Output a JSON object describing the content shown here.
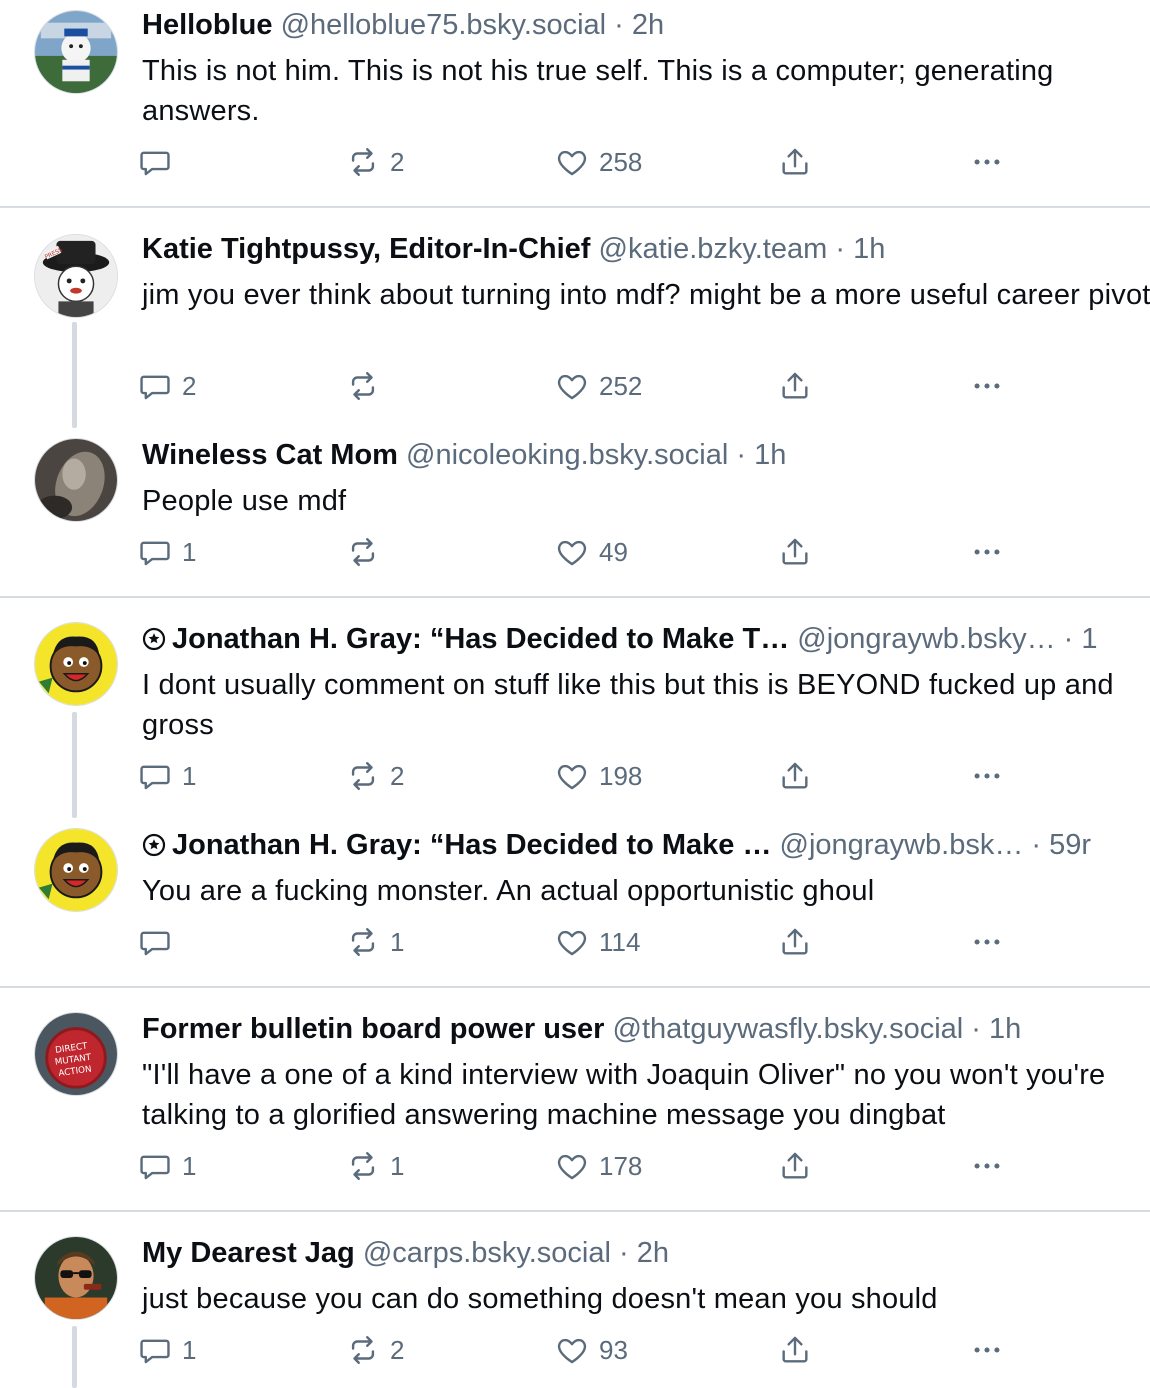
{
  "posts": [
    {
      "name": "Helloblue",
      "handle": "@helloblue75.bsky.social",
      "sep": " · ",
      "time": "2h",
      "text": "This is not him. This is not his true self. This is a computer; generating answers.",
      "reply_count": "",
      "repost_count": "2",
      "like_count": "258",
      "avatar_icon": "stadium-mascot-avatar"
    },
    {
      "name": "Katie Tightpussy, Editor-In-Chief",
      "handle": "@katie.bzky.team",
      "sep": " · ",
      "time": "1h",
      "text": "jim you ever think about turning into mdf? might be a more useful career pivot",
      "reply_count": "2",
      "repost_count": "",
      "like_count": "252",
      "avatar_icon": "press-hat-cartoon-avatar"
    },
    {
      "name": "Wineless Cat Mom",
      "handle": "@nicoleoking.bsky.social",
      "sep": " · ",
      "time": "1h",
      "text": "People use mdf",
      "reply_count": "1",
      "repost_count": "",
      "like_count": "49",
      "avatar_icon": "cat-photo-avatar"
    },
    {
      "name": "Jonathan H. Gray: “Has Decided to Make T…",
      "handle": "@jongraywb.bsky…",
      "sep": " · ",
      "time": "1",
      "text": "I dont usually comment on stuff like this but this is BEYOND fucked up and gross",
      "reply_count": "1",
      "repost_count": "2",
      "like_count": "198",
      "avatar_icon": "cartoon-face-avatar"
    },
    {
      "name": "Jonathan H. Gray: “Has Decided to Make …",
      "handle": "@jongraywb.bsk…",
      "sep": " · ",
      "time": "59r",
      "text": "You are a fucking monster. An actual opportunistic ghoul",
      "reply_count": "",
      "repost_count": "1",
      "like_count": "114",
      "avatar_icon": "cartoon-face-avatar"
    },
    {
      "name": "Former bulletin board power user",
      "handle": "@thatguywasfly.bsky.social",
      "sep": " · ",
      "time": "1h",
      "text": "\"I'll have a one of a kind interview with Joaquin Oliver\" no you won't you're talking to a glorified answering machine message you dingbat",
      "reply_count": "1",
      "repost_count": "1",
      "like_count": "178",
      "avatar_icon": "direct-mutant-action-avatar"
    },
    {
      "name": "My Dearest Jag",
      "handle": "@carps.bsky.social",
      "sep": " · ",
      "time": "2h",
      "text": "just because you can do something doesn't mean you should",
      "reply_count": "1",
      "repost_count": "2",
      "like_count": "93",
      "avatar_icon": "sunglasses-man-avatar"
    }
  ],
  "colors": {
    "text_primary": "#0b0f14",
    "text_secondary": "#5b6b7c",
    "divider": "#d6dce2",
    "thread_line": "#d4dae0"
  },
  "icons": {
    "reply": "reply-icon",
    "repost": "repost-icon",
    "like": "heart-icon",
    "share": "share-icon",
    "more": "more-dots-icon",
    "verified": "verified-badge-icon"
  }
}
